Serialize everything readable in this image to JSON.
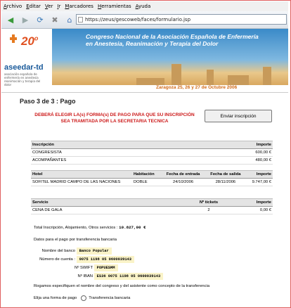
{
  "browser": {
    "menu": [
      "Archivo",
      "Editar",
      "Ver",
      "Ir",
      "Marcadores",
      "Herramientas",
      "Ayuda"
    ],
    "url": "https://zeus/gescoweb/faces/formulario.jsp"
  },
  "banner": {
    "number": "20",
    "ordinal": "o",
    "brand": "aseedar-td",
    "tagline": "asociación española de enfermería en anestesia reanimación y terapia del dolor",
    "title_line1": "Congreso Nacional de la Asociación Española de Enfermería",
    "title_line2": "en Anestesia, Reanimación y Terapia del Dolor",
    "date": "Zaragoza 25, 26 y 27 de Octubre 2006"
  },
  "page": {
    "step": "Paso 3 de 3 : Pago",
    "warning": "DEBERÁ ELEGIR LA(s) FORMA(s) DE PAGO PARA QUE SU INSCRIPCIÓN SEA TRAMITADA POR LA SECRETARIA TECNICA",
    "send_button": "Enviar inscripción"
  },
  "inscripcion": {
    "headers": [
      "Inscripción",
      "Importe"
    ],
    "rows": [
      {
        "name": "CONGRESISTA",
        "amount": "600,00 €"
      },
      {
        "name": "ACOMPAÑANTES",
        "amount": "480,00 €"
      }
    ]
  },
  "hotel": {
    "headers": [
      "Hotel",
      "Habitación",
      "Fecha de entrada",
      "Fecha de salida",
      "Importe"
    ],
    "rows": [
      {
        "name": "SOFITEL MADRID CAMPO DE LAS NACIONES",
        "room": "DOBLE",
        "in": "24/10/2006",
        "out": "28/11/2006",
        "amount": "9.747,00 €"
      }
    ]
  },
  "servicio": {
    "headers": [
      "Servicio",
      "Nº tickets",
      "Importe"
    ],
    "rows": [
      {
        "name": "CENA DE GALA",
        "tickets": "2",
        "amount": "0,00 €"
      }
    ]
  },
  "totals": {
    "label": "Total Inscripción, Alojamiento, Otros servicios :",
    "value": "10.827,00 €"
  },
  "bank": {
    "intro": "Datos para el pago por transferencia bancaria",
    "rows": [
      {
        "label": "Nombre del banco",
        "value": "Banco Popular"
      },
      {
        "label": "Número de cuenta :",
        "value": "0075 1198 05 0600039143"
      },
      {
        "label": "Nº SWIFT",
        "value": "POPUESMM"
      },
      {
        "label": "Nº IBAN",
        "value": "ES36 0075 1198 05 0600039143"
      }
    ],
    "note": "Rogamos especifiquen el nombre del congreso y del asistente como concepto de la transferencia"
  },
  "payment": {
    "prompt": "Elija una forma de pago",
    "option": "Transferencia bancaria"
  }
}
